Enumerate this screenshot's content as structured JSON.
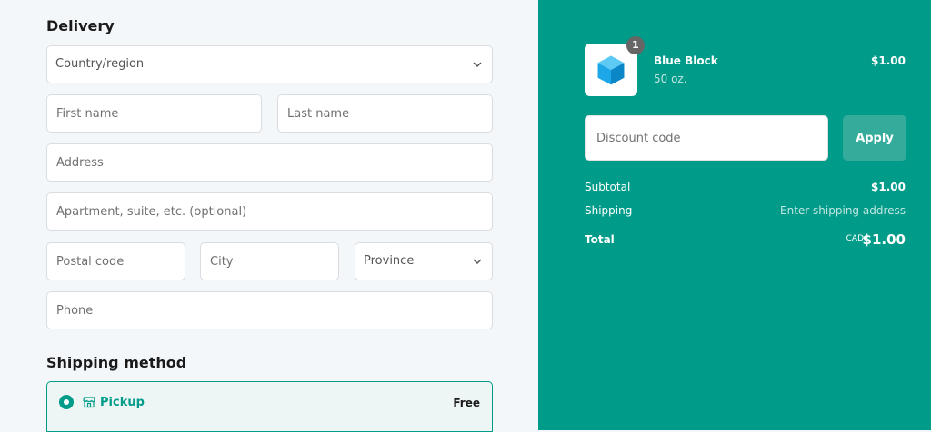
{
  "delivery": {
    "title": "Delivery",
    "country_placeholder": "Country/region",
    "first_name_placeholder": "First name",
    "last_name_placeholder": "Last name",
    "address_placeholder": "Address",
    "apartment_placeholder": "Apartment, suite, etc. (optional)",
    "postal_placeholder": "Postal code",
    "city_placeholder": "City",
    "province_label": "Province",
    "phone_placeholder": "Phone"
  },
  "shipping": {
    "title": "Shipping method",
    "option_label": "Pickup",
    "option_price": "Free",
    "icon": "store-icon"
  },
  "summary": {
    "product": {
      "name": "Blue Block",
      "variant": "50 oz.",
      "price": "$1.00",
      "quantity": "1",
      "image_icon": "cube-icon"
    },
    "discount_placeholder": "Discount code",
    "apply_label": "Apply",
    "subtotal_label": "Subtotal",
    "subtotal_value": "$1.00",
    "shipping_label": "Shipping",
    "shipping_value": "Enter shipping address",
    "total_label": "Total",
    "currency": "CAD",
    "total_value": "$1.00"
  },
  "colors": {
    "accent": "#019b89",
    "panel_bg": "#f4f7f9",
    "apply_button": "#34ab9b"
  }
}
